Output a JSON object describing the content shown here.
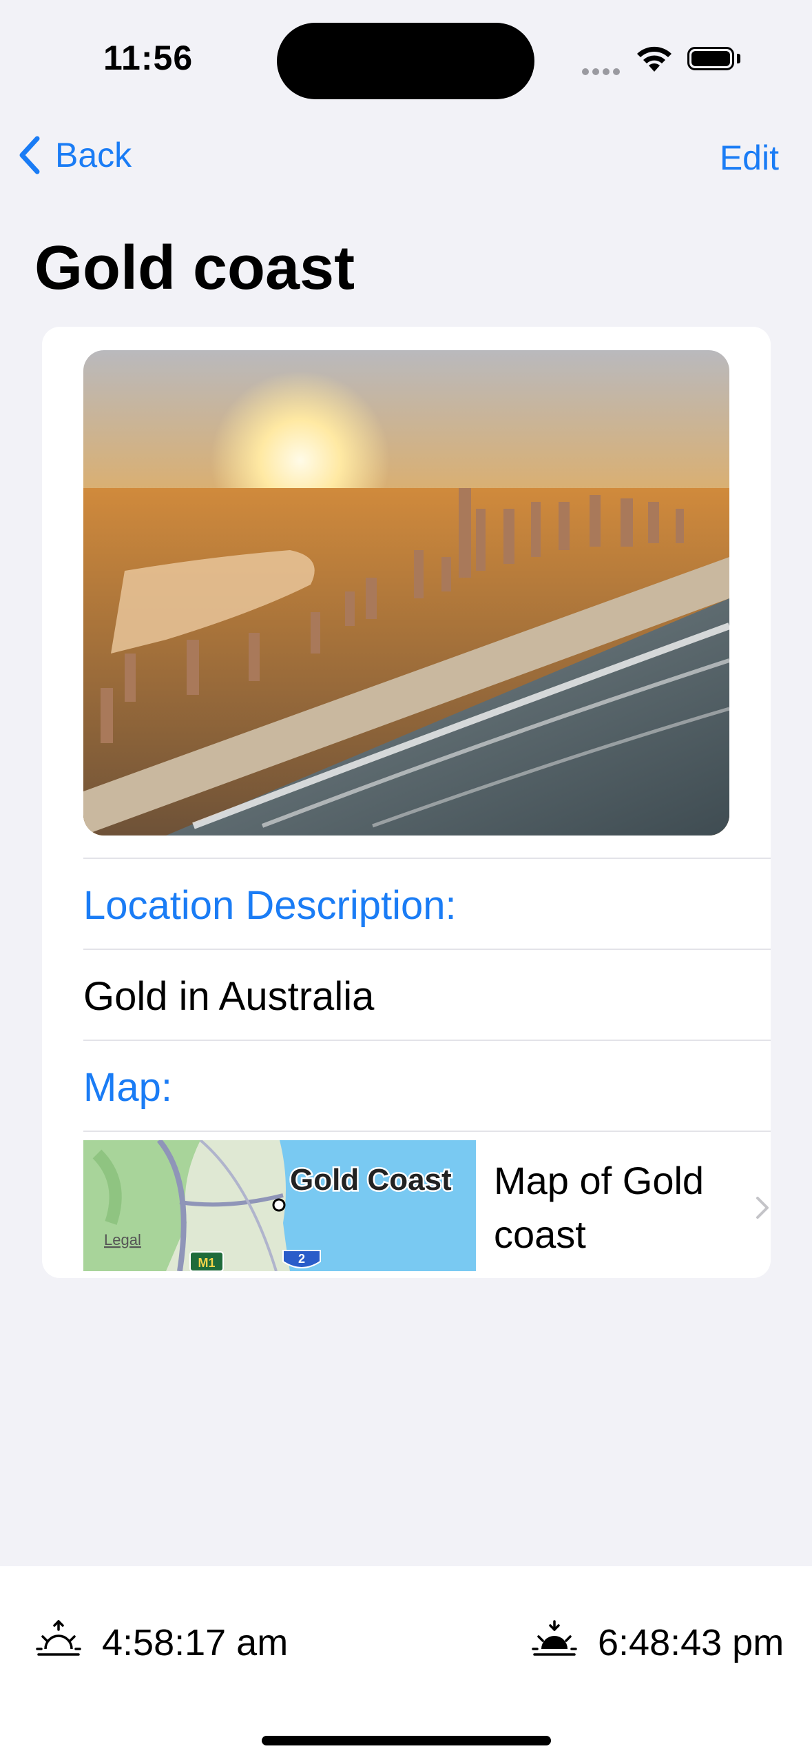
{
  "status": {
    "time": "11:56"
  },
  "nav": {
    "back_label": "Back",
    "edit_label": "Edit",
    "title": "Gold coast"
  },
  "detail": {
    "location_header": "Location Description:",
    "location_value": "Gold in Australia",
    "map_header": "Map:",
    "map_thumb_city": "Gold Coast",
    "map_thumb_legal": "Legal",
    "map_thumb_shield_m1": "M1",
    "map_thumb_shield_2": "2",
    "map_link_label": "Map of Gold coast"
  },
  "bottom": {
    "sunrise": "4:58:17 am",
    "sunset": "6:48:43 pm"
  },
  "colors": {
    "accent": "#1a7cf5",
    "background": "#f2f2f7",
    "card": "#ffffff"
  },
  "icons": [
    "chevron-left-icon",
    "wifi-icon",
    "battery-icon",
    "chevron-right-icon",
    "sunrise-icon",
    "sunset-icon"
  ]
}
